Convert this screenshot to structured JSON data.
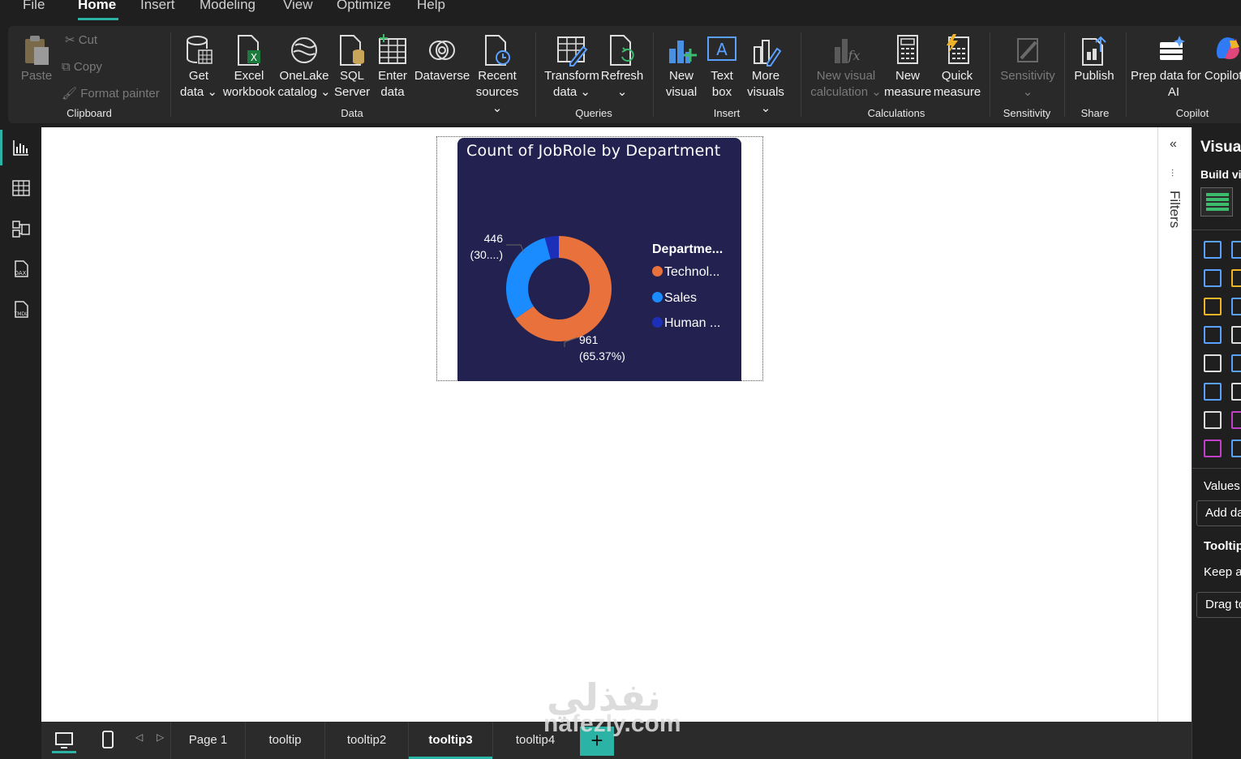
{
  "menu": {
    "items": [
      "File",
      "Home",
      "Insert",
      "Modeling",
      "View",
      "Optimize",
      "Help"
    ],
    "active": "Home"
  },
  "ribbon": {
    "clipboard": {
      "paste": "Paste",
      "cut": "Cut",
      "copy": "Copy",
      "format_painter": "Format painter",
      "label": "Clipboard"
    },
    "data": {
      "get_data": [
        "Get",
        "data ⌄"
      ],
      "excel": [
        "Excel",
        "workbook"
      ],
      "onelake": [
        "OneLake",
        "catalog ⌄"
      ],
      "sql": [
        "SQL",
        "Server"
      ],
      "enter": [
        "Enter",
        "data"
      ],
      "dataverse": [
        "Dataverse"
      ],
      "recent": [
        "Recent",
        "sources ⌄"
      ],
      "label": "Data"
    },
    "queries": {
      "transform": [
        "Transform",
        "data ⌄"
      ],
      "refresh": [
        "Refresh",
        "⌄"
      ],
      "label": "Queries"
    },
    "insert": {
      "new_visual": [
        "New",
        "visual"
      ],
      "text_box": [
        "Text",
        "box"
      ],
      "more_visuals": [
        "More",
        "visuals ⌄"
      ],
      "label": "Insert"
    },
    "calculations": {
      "new_visual_calc": [
        "New visual",
        "calculation ⌄"
      ],
      "new_measure": [
        "New",
        "measure"
      ],
      "quick_measure": [
        "Quick",
        "measure"
      ],
      "label": "Calculations"
    },
    "sensitivity": {
      "btn": [
        "Sensitivity",
        "⌄"
      ],
      "label": "Sensitivity"
    },
    "share": {
      "publish": [
        "Publish"
      ],
      "label": "Share"
    },
    "copilot": {
      "prep": [
        "Prep data for Copilot",
        "AI"
      ],
      "label": "Copilot"
    }
  },
  "visual": {
    "title": "Count of JobRole by Department",
    "legend_title": "Departme...",
    "labels": {
      "top_value": "446",
      "top_pct": "(30....)",
      "bottom_value": "961",
      "bottom_pct": "(65.37%)"
    }
  },
  "chart_data": {
    "type": "pie",
    "title": "Count of JobRole by Department",
    "legend_title": "Departme...",
    "legend_position": "right",
    "categories": [
      "Technol...",
      "Sales",
      "Human ..."
    ],
    "values": [
      961,
      446,
      63
    ],
    "colors": [
      "#e8713c",
      "#1a8cff",
      "#1c2fb8"
    ],
    "donut": true
  },
  "filters": {
    "label": "Filters"
  },
  "viz_pane": {
    "title": "Visual",
    "build": "Build vi",
    "values": "Values",
    "add_data": "Add da",
    "tooltips": "Tooltip",
    "keep": "Keep a",
    "drag": "Drag to"
  },
  "pages": {
    "tabs": [
      "Page 1",
      "tooltip",
      "tooltip2",
      "tooltip3",
      "tooltip4"
    ],
    "active_index": 3
  },
  "watermark": {
    "arabic": "نفذلي",
    "latin": "nafezly.com"
  },
  "colors": {
    "accent": "#2bb3a5",
    "visual_bg": "#222150"
  }
}
